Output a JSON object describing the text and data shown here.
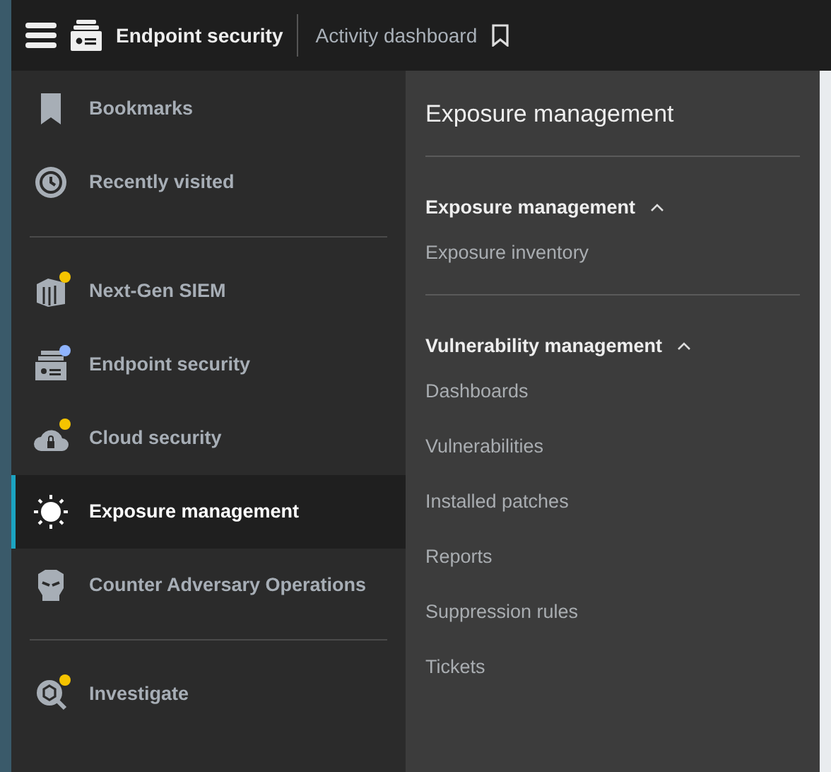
{
  "header": {
    "product": "Endpoint security",
    "page": "Activity dashboard"
  },
  "sidebar": {
    "groups": [
      {
        "items": [
          {
            "label": "Bookmarks",
            "kind": "bookmark",
            "selected": false
          },
          {
            "label": "Recently visited",
            "kind": "clock",
            "selected": false
          }
        ]
      },
      {
        "items": [
          {
            "label": "Next-Gen SIEM",
            "kind": "siem",
            "selected": false,
            "color": "#f5c400"
          },
          {
            "label": "Endpoint security",
            "kind": "endpoint",
            "selected": false,
            "color": "#8fb4ff"
          },
          {
            "label": "Cloud security",
            "kind": "cloud",
            "selected": false,
            "color": "#f5c400"
          },
          {
            "label": "Exposure management",
            "kind": "sun",
            "selected": true
          },
          {
            "label": "Counter Adversary Operations",
            "kind": "mask",
            "selected": false
          }
        ]
      },
      {
        "items": [
          {
            "label": "Investigate",
            "kind": "investigate",
            "selected": false,
            "color": "#f5c400"
          }
        ]
      }
    ]
  },
  "panel": {
    "title": "Exposure management",
    "sections": [
      {
        "title": "Exposure management",
        "expanded": true,
        "items": [
          "Exposure inventory"
        ]
      },
      {
        "title": "Vulnerability management",
        "expanded": true,
        "items": [
          "Dashboards",
          "Vulnerabilities",
          "Installed patches",
          "Reports",
          "Suppression rules",
          "Tickets"
        ]
      }
    ]
  }
}
